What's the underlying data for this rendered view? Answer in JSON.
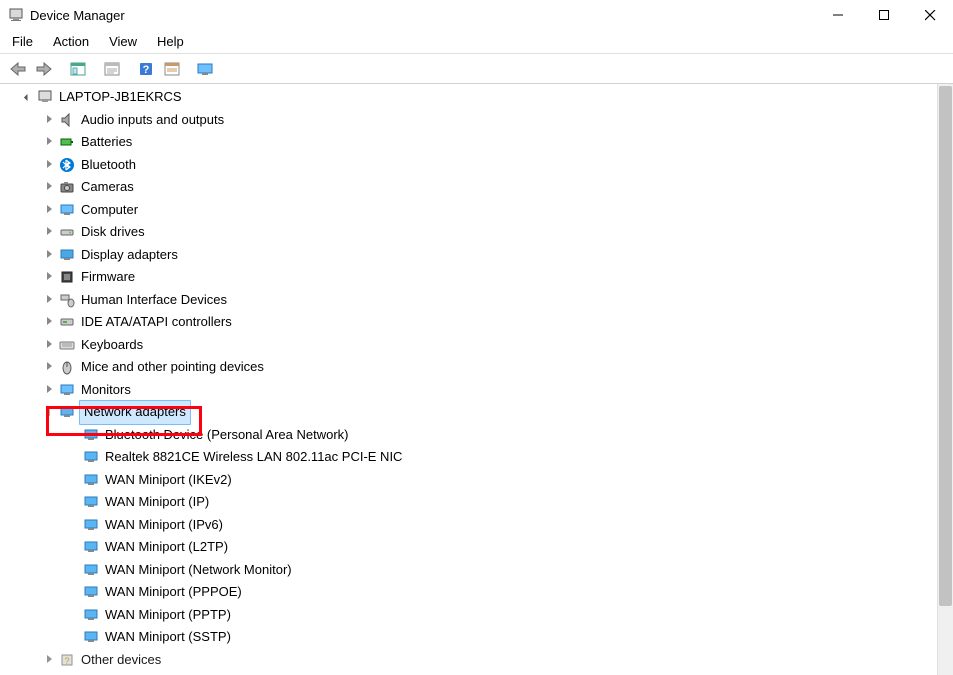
{
  "window": {
    "title": "Device Manager"
  },
  "menu": {
    "items": [
      "File",
      "Action",
      "View",
      "Help"
    ]
  },
  "root": {
    "label": "LAPTOP-JB1EKRCS"
  },
  "categories": [
    {
      "icon": "audio",
      "label": "Audio inputs and outputs"
    },
    {
      "icon": "battery",
      "label": "Batteries"
    },
    {
      "icon": "bluetooth",
      "label": "Bluetooth"
    },
    {
      "icon": "camera",
      "label": "Cameras"
    },
    {
      "icon": "computer",
      "label": "Computer"
    },
    {
      "icon": "disk",
      "label": "Disk drives"
    },
    {
      "icon": "display",
      "label": "Display adapters"
    },
    {
      "icon": "firmware",
      "label": "Firmware"
    },
    {
      "icon": "hid",
      "label": "Human Interface Devices"
    },
    {
      "icon": "ide",
      "label": "IDE ATA/ATAPI controllers"
    },
    {
      "icon": "keyboard",
      "label": "Keyboards"
    },
    {
      "icon": "mouse",
      "label": "Mice and other pointing devices"
    },
    {
      "icon": "monitor",
      "label": "Monitors"
    },
    {
      "icon": "network",
      "label": "Network adapters",
      "selected": true,
      "expanded": true
    },
    {
      "icon": "other",
      "label": "Other devices",
      "partial": true
    }
  ],
  "network_children": [
    "Bluetooth Device (Personal Area Network)",
    "Realtek 8821CE Wireless LAN 802.11ac PCI-E NIC",
    "WAN Miniport (IKEv2)",
    "WAN Miniport (IP)",
    "WAN Miniport (IPv6)",
    "WAN Miniport (L2TP)",
    "WAN Miniport (Network Monitor)",
    "WAN Miniport (PPPOE)",
    "WAN Miniport (PPTP)",
    "WAN Miniport (SSTP)"
  ]
}
